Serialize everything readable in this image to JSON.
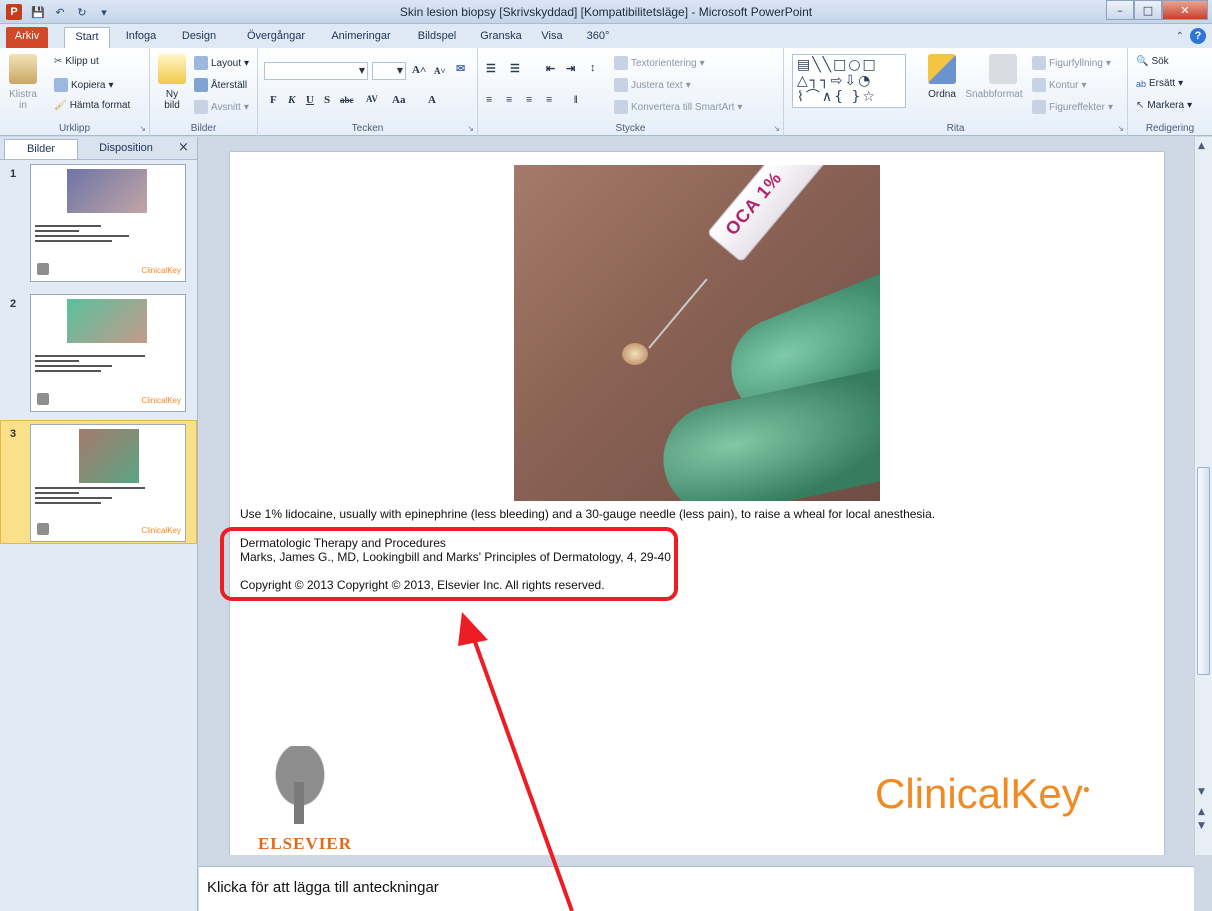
{
  "window": {
    "title": "Skin lesion biopsy [Skrivskyddad] [Kompatibilitetsläge] - Microsoft PowerPoint",
    "app_icon_letter": "P"
  },
  "tabs": [
    {
      "label": "Arkiv"
    },
    {
      "label": "Start"
    },
    {
      "label": "Infoga"
    },
    {
      "label": "Design"
    },
    {
      "label": "Övergångar"
    },
    {
      "label": "Animeringar"
    },
    {
      "label": "Bildspel"
    },
    {
      "label": "Granska"
    },
    {
      "label": "Visa"
    },
    {
      "label": "360°"
    }
  ],
  "ribbon": {
    "clipboard": {
      "label": "Urklipp",
      "paste": "Klistra in",
      "cut": "Klipp ut",
      "copy": "Kopiera",
      "format_painter": "Hämta format"
    },
    "slides": {
      "label": "Bilder",
      "new_slide": "Ny bild",
      "layout": "Layout",
      "reset": "Återställ",
      "section": "Avsnitt"
    },
    "font": {
      "label": "Tecken"
    },
    "paragraph": {
      "label": "Stycke",
      "text_direction": "Textorientering",
      "align_text": "Justera text",
      "smartart": "Konvertera till SmartArt"
    },
    "drawing": {
      "label": "Rita",
      "arrange": "Ordna",
      "quick_styles": "Snabbformat",
      "shape_fill": "Figurfyllning",
      "shape_outline": "Kontur",
      "shape_effects": "Figureffekter"
    },
    "editing": {
      "label": "Redigering",
      "find": "Sök",
      "replace": "Ersätt",
      "select": "Markera"
    }
  },
  "left_panel": {
    "tab_slides": "Bilder",
    "tab_outline": "Disposition",
    "close": "×",
    "thumbs": [
      {
        "num": "1",
        "brand": "ClinicalKey"
      },
      {
        "num": "2",
        "brand": "ClinicalKey"
      },
      {
        "num": "3",
        "brand": "ClinicalKey"
      }
    ]
  },
  "slide": {
    "syringe_label": "OCA 1%",
    "caption": "Use 1% lidocaine, usually with epinephrine (less bleeding) and a 30-gauge needle (less pain), to raise a wheal for local anesthesia.",
    "source_title": "Dermatologic Therapy and Procedures",
    "source_citation": "Marks, James G., MD,  Lookingbill and Marks' Principles of Dermatology, 4, 29-40",
    "copyright": "Copyright ©  2013   Copyright © 2013, Elsevier Inc. All rights reserved.",
    "publisher_logo": "ELSEVIER",
    "brand": "ClinicalKey"
  },
  "notes": {
    "placeholder": "Klicka för att lägga till anteckningar"
  },
  "colors": {
    "file_tab": "#d2492a",
    "annotation_red": "#ee1c24",
    "clinicalkey_orange": "#f08a24",
    "thumb_selected": "#fbe08a"
  }
}
